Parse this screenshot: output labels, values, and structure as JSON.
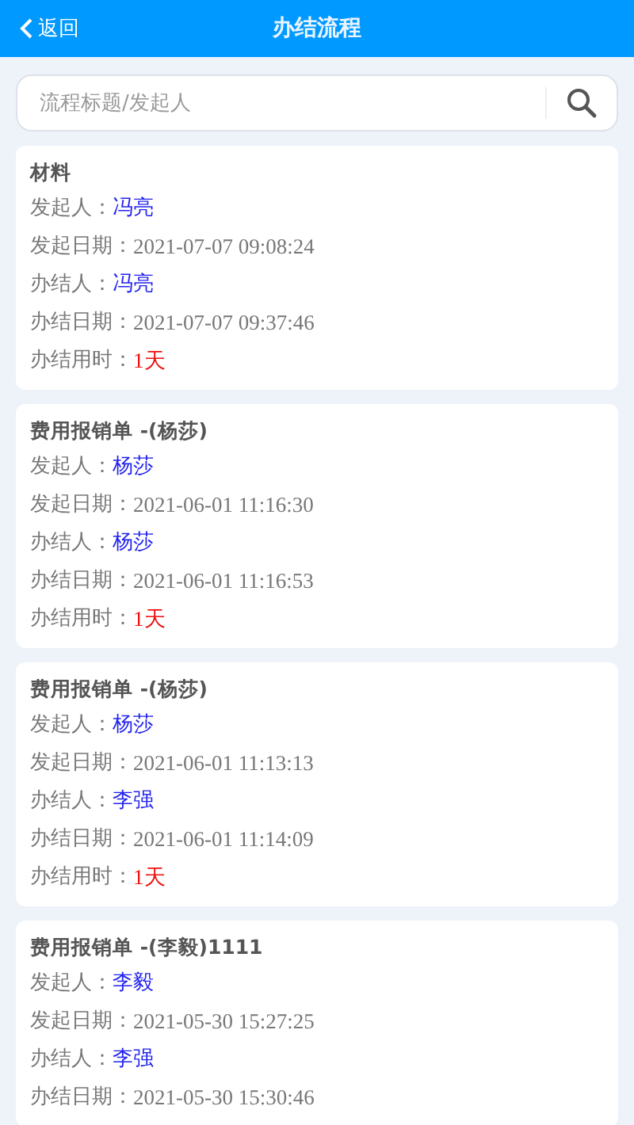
{
  "header": {
    "back": "返回",
    "title": "办结流程"
  },
  "search": {
    "placeholder": "流程标题/发起人"
  },
  "cards": [
    {
      "title": "材料",
      "rows": [
        {
          "label": "发起人：",
          "value": "冯亮",
          "kind": "person"
        },
        {
          "label": "发起日期：",
          "value": "2021-07-07 09:08:24",
          "kind": "date"
        },
        {
          "label": "办结人：",
          "value": "冯亮",
          "kind": "person"
        },
        {
          "label": "办结日期：",
          "value": "2021-07-07 09:37:46",
          "kind": "date"
        },
        {
          "label": "办结用时：",
          "value": "1天",
          "kind": "duration"
        }
      ]
    },
    {
      "title": "费用报销单 -(杨莎)",
      "rows": [
        {
          "label": "发起人：",
          "value": "杨莎",
          "kind": "person"
        },
        {
          "label": "发起日期：",
          "value": "2021-06-01 11:16:30",
          "kind": "date"
        },
        {
          "label": "办结人：",
          "value": "杨莎",
          "kind": "person"
        },
        {
          "label": "办结日期：",
          "value": "2021-06-01 11:16:53",
          "kind": "date"
        },
        {
          "label": "办结用时：",
          "value": "1天",
          "kind": "duration"
        }
      ]
    },
    {
      "title": "费用报销单 -(杨莎)",
      "rows": [
        {
          "label": "发起人：",
          "value": "杨莎",
          "kind": "person"
        },
        {
          "label": "发起日期：",
          "value": "2021-06-01 11:13:13",
          "kind": "date"
        },
        {
          "label": "办结人：",
          "value": "李强",
          "kind": "person"
        },
        {
          "label": "办结日期：",
          "value": "2021-06-01 11:14:09",
          "kind": "date"
        },
        {
          "label": "办结用时：",
          "value": "1天",
          "kind": "duration"
        }
      ]
    },
    {
      "title": "费用报销单 -(李毅)1111",
      "rows": [
        {
          "label": "发起人：",
          "value": "李毅",
          "kind": "person"
        },
        {
          "label": "发起日期：",
          "value": "2021-05-30 15:27:25",
          "kind": "date"
        },
        {
          "label": "办结人：",
          "value": "李强",
          "kind": "person"
        },
        {
          "label": "办结日期：",
          "value": "2021-05-30 15:30:46",
          "kind": "date"
        }
      ]
    }
  ]
}
